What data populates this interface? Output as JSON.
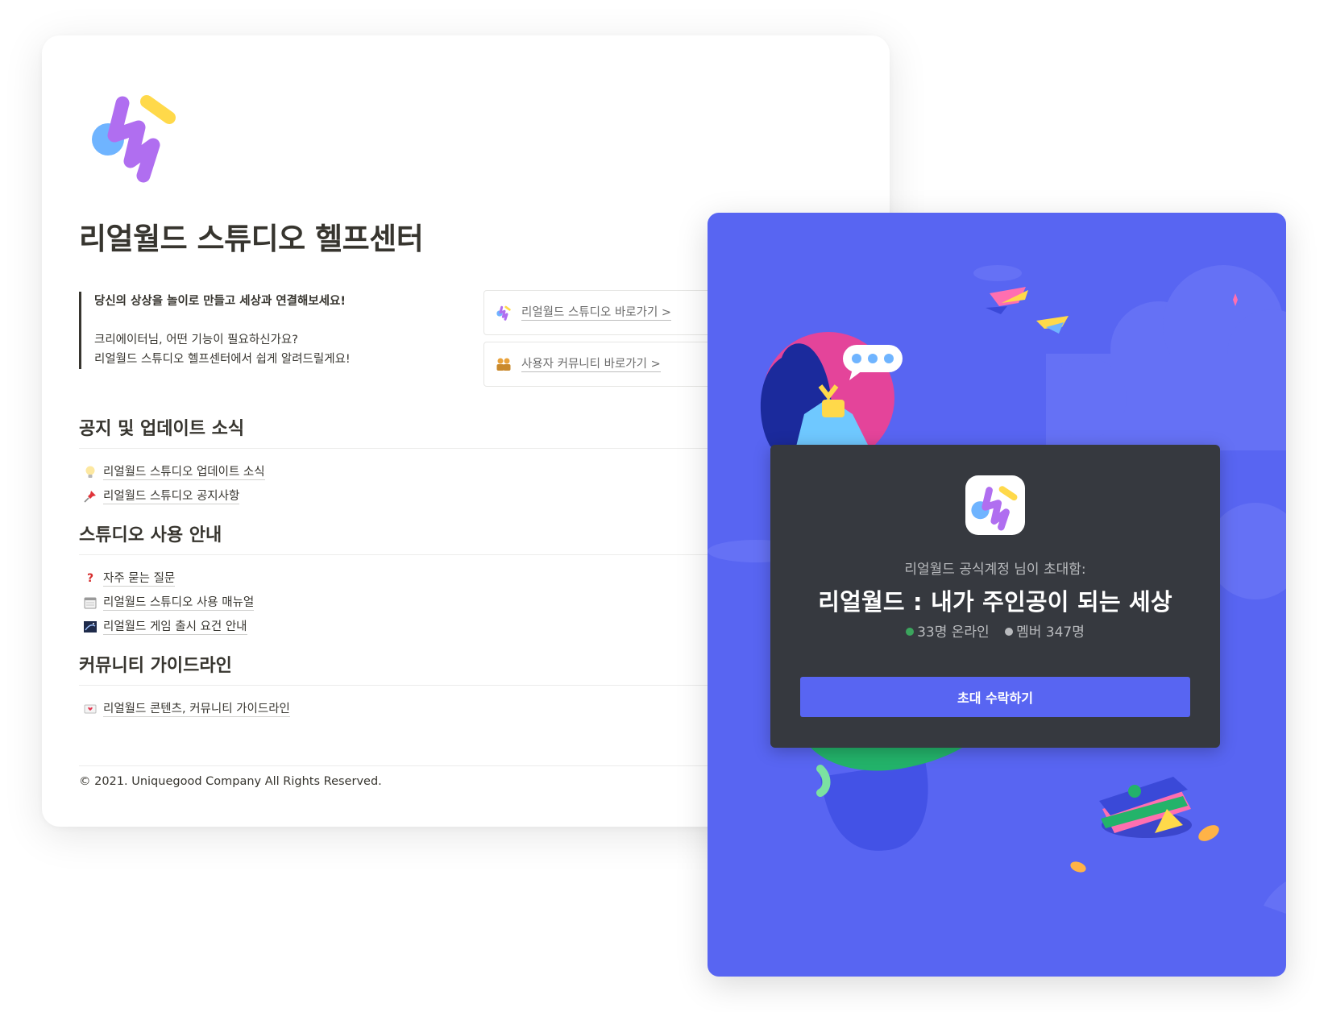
{
  "help_center": {
    "title": "리얼월드 스튜디오 헬프센터",
    "intro": {
      "line1": "당신의 상상을 놀이로 만들고 세상과 연결해보세요!",
      "line2": "크리에이터님, 어떤 기능이 필요하신가요?",
      "line3": "리얼월드 스튜디오 헬프센터에서 쉽게 알려드릴게요!"
    },
    "links": [
      {
        "label": "리얼월드 스튜디오 바로가기 >",
        "icon": "app-logo-icon"
      },
      {
        "label": "사용자 커뮤니티 바로가기 >",
        "icon": "people-icon"
      }
    ],
    "sections": [
      {
        "heading": "공지 및 업데이트 소식",
        "items": [
          {
            "label": "리얼월드 스튜디오 업데이트 소식",
            "icon": "lightbulb-icon"
          },
          {
            "label": "리얼월드 스튜디오 공지사항",
            "icon": "pushpin-icon"
          }
        ]
      },
      {
        "heading": "스튜디오 사용 안내",
        "items": [
          {
            "label": "자주 묻는 질문",
            "icon": "question-mark-icon"
          },
          {
            "label": "리얼월드 스튜디오 사용 매뉴얼",
            "icon": "calendar-icon"
          },
          {
            "label": "리얼월드 게임 출시 요건 안내",
            "icon": "night-sky-icon"
          }
        ]
      },
      {
        "heading": "커뮤니티 가이드라인",
        "items": [
          {
            "label": "리얼월드 콘텐츠, 커뮤니티 가이드라인",
            "icon": "love-letter-icon"
          }
        ]
      }
    ],
    "copyright": "© 2021. Uniquegood Company All Rights Reserved."
  },
  "invite": {
    "invited_by": "리얼월드 공식계정 님이 초대함:",
    "server_name": "리얼월드 : 내가 주인공이 되는 세상",
    "online": "33명 온라인",
    "members": "멤버 347명",
    "accept_label": "초대 수락하기",
    "colors": {
      "background": "#5865f2",
      "panel": "#36393f",
      "button": "#5865f2",
      "online_dot": "#3ba55d",
      "member_dot": "#b9bbbe"
    }
  },
  "brand_colors": {
    "logo_blue": "#6fb4ff",
    "logo_purple": "#b06ef0",
    "logo_yellow": "#ffd94a"
  }
}
